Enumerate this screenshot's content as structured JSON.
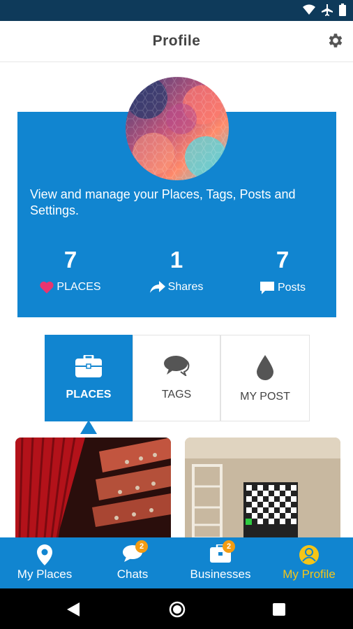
{
  "colors": {
    "accent": "#1185d0",
    "status_bar": "#0e3a5a",
    "active_nav": "#f5c518",
    "badge": "#f39c12"
  },
  "app": {
    "title": "Profile"
  },
  "profile_card": {
    "description": "View and manage your Places, Tags, Posts and Settings.",
    "stats": [
      {
        "value": "7",
        "label": "PLACES",
        "icon": "heart-icon"
      },
      {
        "value": "1",
        "label": "Shares",
        "icon": "share-icon"
      },
      {
        "value": "7",
        "label": "Posts",
        "icon": "comment-icon"
      }
    ]
  },
  "tabs": [
    {
      "label": "PLACES",
      "icon": "briefcase-icon",
      "active": true
    },
    {
      "label": "TAGS",
      "icon": "speech-bubbles-icon",
      "active": false
    },
    {
      "label": "MY POST",
      "icon": "drop-icon",
      "active": false
    }
  ],
  "bottom_nav": [
    {
      "label": "My Places",
      "icon": "location-pin-icon",
      "badge": ""
    },
    {
      "label": "Chats",
      "icon": "chat-icon",
      "badge": "2"
    },
    {
      "label": "Businesses",
      "icon": "briefcase-icon",
      "badge": "2"
    },
    {
      "label": "My Profile",
      "icon": "user-icon",
      "badge": "",
      "active": true
    }
  ]
}
